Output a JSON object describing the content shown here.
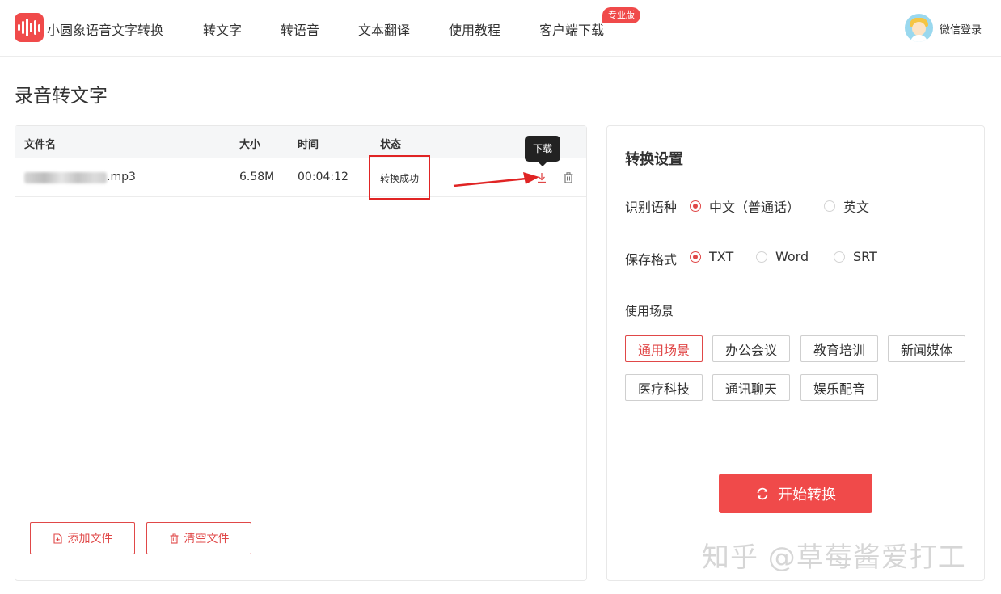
{
  "header": {
    "brand": "小圆象语音文字转换",
    "nav": [
      "转文字",
      "转语音",
      "文本翻译",
      "使用教程",
      "客户端下载"
    ],
    "pro_badge": "专业版",
    "login": "微信登录"
  },
  "page_title": "录音转文字",
  "file_table": {
    "columns": [
      "文件名",
      "大小",
      "时间",
      "状态"
    ],
    "rows": [
      {
        "name_suffix": ".mp3",
        "size": "6.58M",
        "duration": "00:04:12",
        "status": "转换成功"
      }
    ],
    "download_tooltip": "下载"
  },
  "actions": {
    "add_file": "添加文件",
    "clear_files": "清空文件"
  },
  "settings": {
    "title": "转换设置",
    "language": {
      "label": "识别语种",
      "options": [
        "中文（普通话）",
        "英文"
      ],
      "selected": "中文（普通话）"
    },
    "format": {
      "label": "保存格式",
      "options": [
        "TXT",
        "Word",
        "SRT"
      ],
      "selected": "TXT"
    },
    "scene": {
      "label": "使用场景",
      "options": [
        "通用场景",
        "办公会议",
        "教育培训",
        "新闻媒体",
        "医疗科技",
        "通讯聊天",
        "娱乐配音"
      ],
      "selected": "通用场景"
    },
    "start_button": "开始转换"
  },
  "watermark": "知乎 @草莓酱爱打工",
  "colors": {
    "accent": "#f04a4a",
    "annotation_red": "#e02424"
  }
}
